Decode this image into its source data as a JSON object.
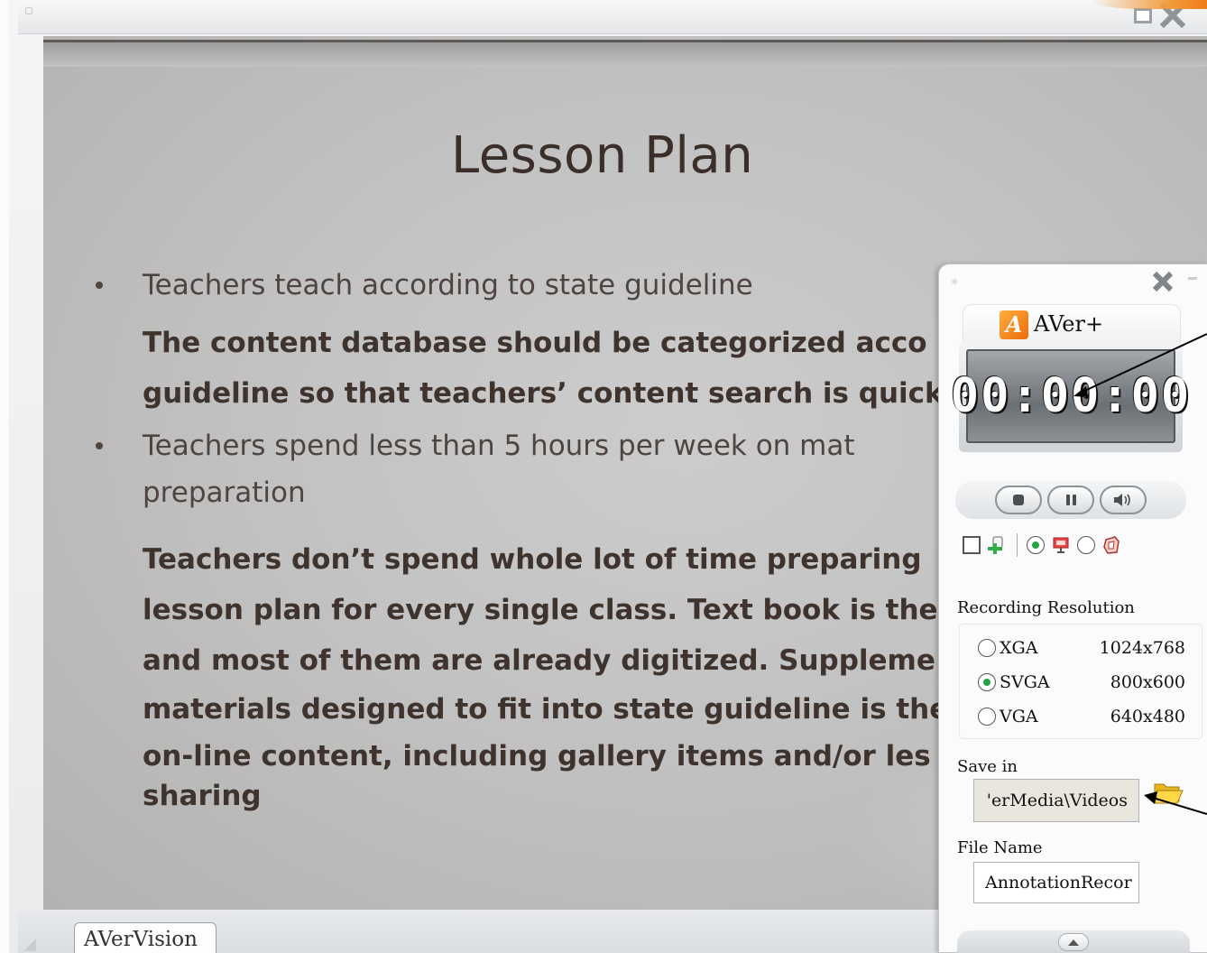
{
  "window": {
    "tab_label": "AVerVision"
  },
  "slide": {
    "title": "Lesson Plan",
    "lines": [
      "Teachers teach according to state guideline",
      "The content database should be categorized acco",
      "guideline so that teachers’ content search is quick",
      "Teachers spend less than 5 hours per week on mat",
      "preparation",
      "Teachers don’t spend whole lot of time preparing",
      "lesson plan for every single class.  Text book is the",
      "and most of them are already digitized.  Suppleme",
      "materials designed to fit into state guideline is the",
      "on-line content, including gallery items and/or les",
      "sharing"
    ]
  },
  "recorder": {
    "logo_glyph": "A",
    "title": "AVer+",
    "timer": "00:00:00",
    "recording_resolution_label": "Recording Resolution",
    "resolutions": [
      {
        "name": "XGA",
        "size": "1024x768",
        "selected": false
      },
      {
        "name": "SVGA",
        "size": "800x600",
        "selected": true
      },
      {
        "name": "VGA",
        "size": "640x480",
        "selected": false
      }
    ],
    "save_in_label": "Save in",
    "save_in_value": "'erMedia\\Videos",
    "file_name_label": "File Name",
    "file_name_value": "AnnotationRecor"
  },
  "icons": {
    "window_close": "close-icon",
    "window_maximize": "maximize-icon",
    "recorder_close": "close-icon",
    "stop": "stop-icon",
    "pause": "pause-icon",
    "volume": "speaker-icon",
    "add_audio": "add-audio-icon",
    "camera_source": "presenter-monitor-icon",
    "pc_source": "pc-source-icon",
    "folder": "folder-open-icon",
    "collapse": "chevron-up-icon"
  },
  "colors": {
    "accent_orange": "#f07c1a",
    "radio_selected": "#26a245",
    "callout_arrow": "#000000"
  }
}
